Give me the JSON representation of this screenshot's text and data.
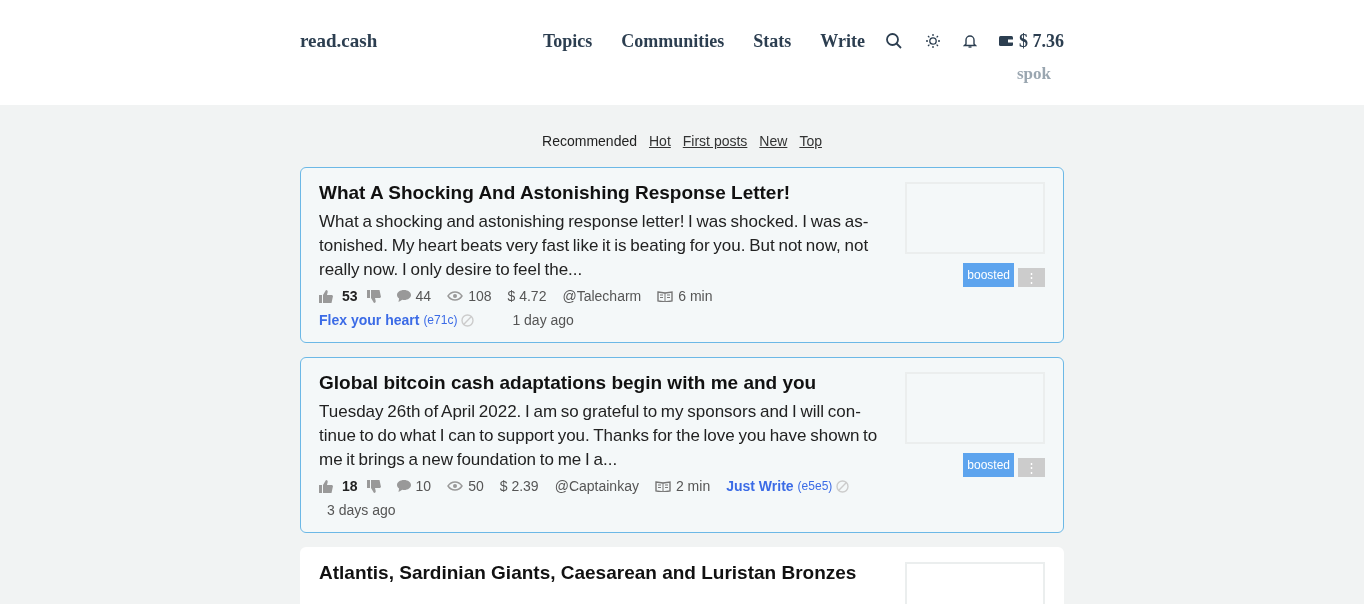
{
  "header": {
    "logo": "read.cash",
    "nav": [
      "Topics",
      "Communities",
      "Stats",
      "Write"
    ],
    "balance": "$ 7.36",
    "username": "spok"
  },
  "tabs": [
    {
      "label": "Recommended",
      "selected": true
    },
    {
      "label": "Hot",
      "selected": false
    },
    {
      "label": "First posts",
      "selected": false
    },
    {
      "label": "New",
      "selected": false
    },
    {
      "label": "Top",
      "selected": false
    }
  ],
  "articles": [
    {
      "title": "What A Shocking And Astonishing Response Letter!",
      "excerpt": "What a shocking and astonishing response letter! I was shocked. I was as-tonished. My heart beats very fast like it is beating for you. But not now, not really now. I only desire to feel the...",
      "boosted": true,
      "badge": "boosted",
      "more": "⋮",
      "likes": "53",
      "comments": "44",
      "views": "108",
      "earned": "$ 4.72",
      "author": "@Talecharm",
      "read_time": "6 min",
      "community": "Flex your heart",
      "community_code": "(e71c)",
      "time": "1 day ago"
    },
    {
      "title": "Global bitcoin cash adaptations begin with me and you",
      "excerpt": "Tuesday 26th of April 2022. I am so grateful to my sponsors and I will con-tinue to do what I can to support you. Thanks for the love you have shown to me it brings a new foundation to me I a...",
      "boosted": true,
      "badge": "boosted",
      "more": "⋮",
      "likes": "18",
      "comments": "10",
      "views": "50",
      "earned": "$ 2.39",
      "author": "@Captainkay",
      "read_time": "2 min",
      "community": "Just Write",
      "community_code": "(e5e5)",
      "time": "3 days ago"
    },
    {
      "title": "Atlantis, Sardinian Giants, Caesarean and Luristan Bronzes",
      "boosted": false
    }
  ]
}
